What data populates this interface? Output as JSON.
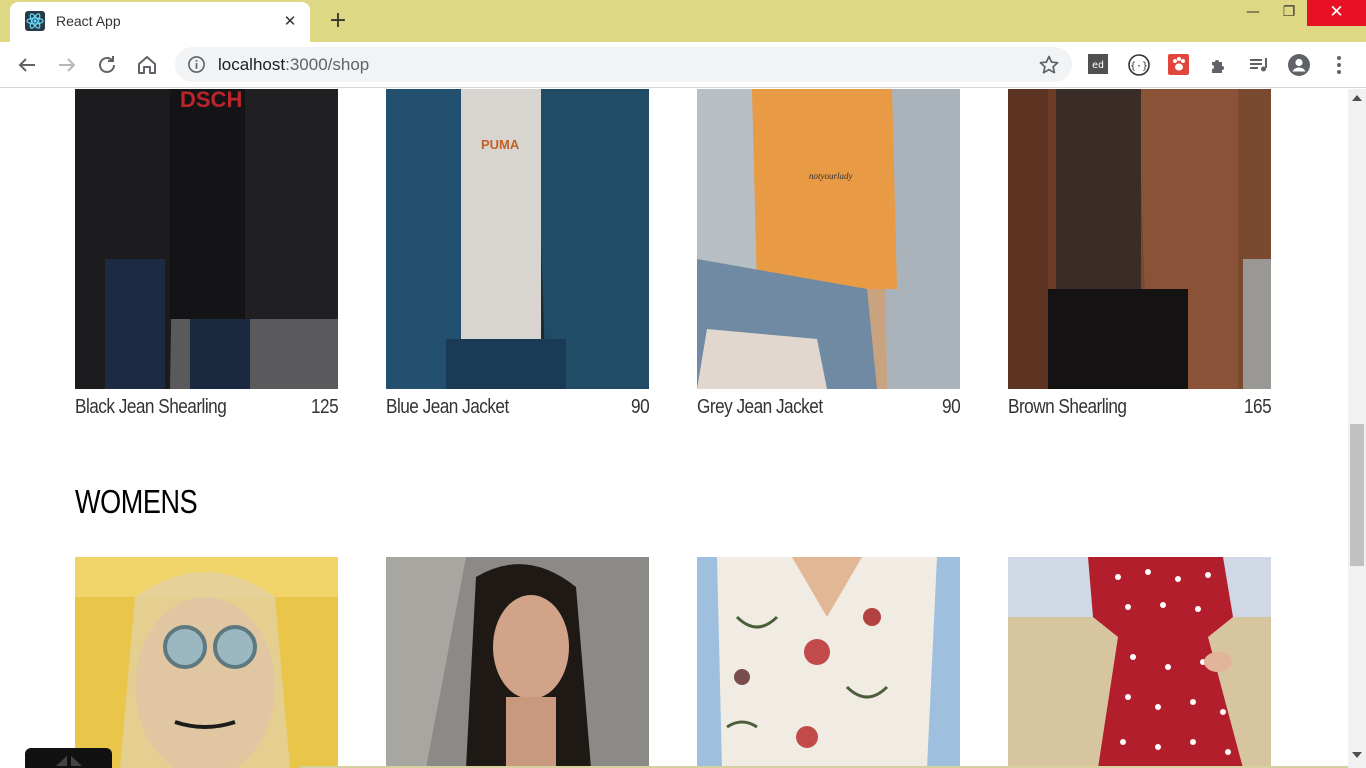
{
  "browser": {
    "tab_title": "React App",
    "tab_close": "✕",
    "new_tab": "+",
    "url_host": "localhost",
    "url_path": ":3000/shop",
    "window_minimize": "—",
    "window_maximize": "❐",
    "window_close": "✕",
    "frame_color": "#ded783"
  },
  "shop": {
    "products_top": [
      {
        "name": "Black Jean Shearling",
        "price": "125"
      },
      {
        "name": "Blue Jean Jacket",
        "price": "90"
      },
      {
        "name": "Grey Jean Jacket",
        "price": "90"
      },
      {
        "name": "Brown Shearling",
        "price": "165"
      }
    ],
    "section_title": "WOMENS"
  }
}
